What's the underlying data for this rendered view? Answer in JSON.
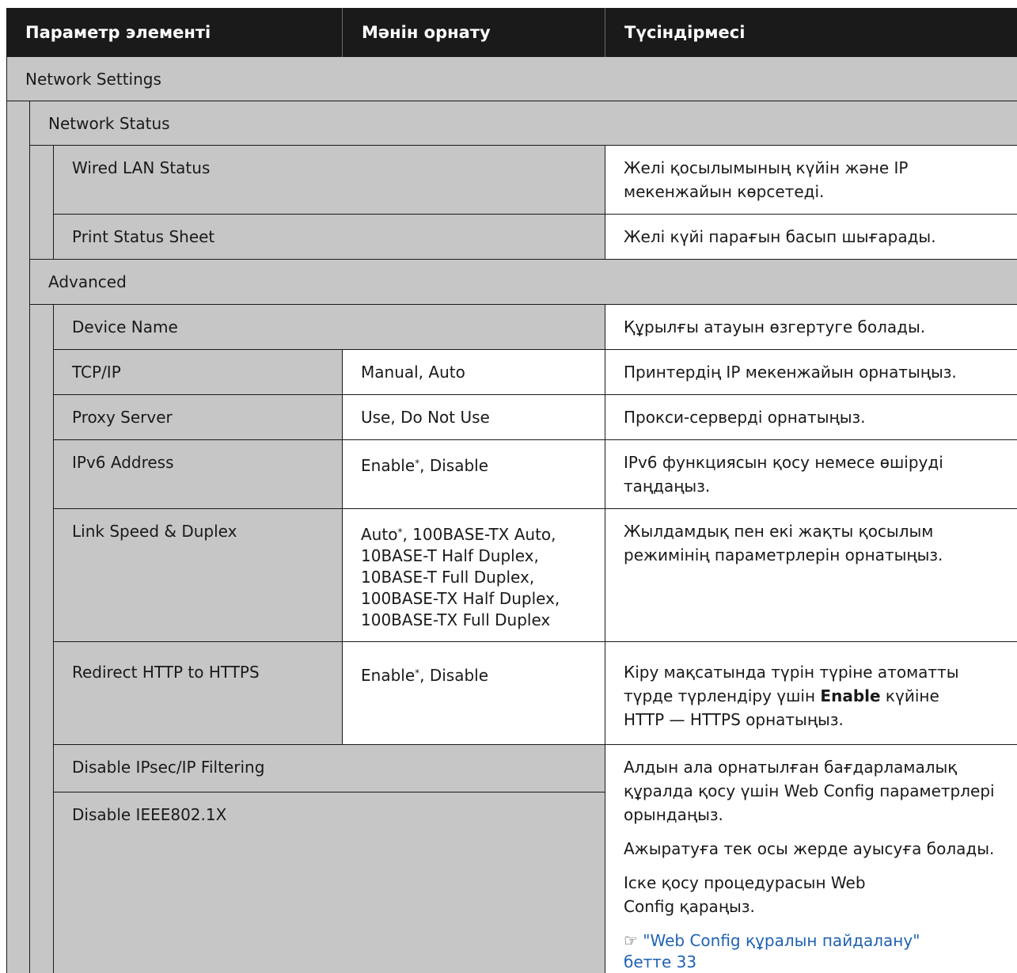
{
  "header": {
    "col1": "Параметр элементі",
    "col2": "Мәнін орнату",
    "col3": "Түсіндірмесі"
  },
  "sections": {
    "network_settings": "Network Settings",
    "network_status": "Network Status",
    "advanced": "Advanced"
  },
  "rows": {
    "wired_lan": {
      "name": "Wired LAN Status",
      "desc_1": "Желі қосылымының күйін және IP",
      "desc_2": "мекенжайын көрсетеді."
    },
    "print_status": {
      "name": "Print Status Sheet",
      "desc": "Желі күйі парағын басып шығарады."
    },
    "device_name": {
      "name": "Device Name",
      "desc": "Құрылғы атауын өзгертуге болады."
    },
    "tcpip": {
      "name": "TCP/IP",
      "value": "Manual, Auto",
      "desc": "Принтердің IP мекенжайын орнатыңыз."
    },
    "proxy": {
      "name": "Proxy Server",
      "value": "Use, Do Not Use",
      "desc": "Прокси-серверді орнатыңыз."
    },
    "ipv6": {
      "name": "IPv6 Address",
      "value_a": "Enable",
      "value_b": ", Disable",
      "desc_1": "IPv6 функциясын қосу немесе өшіруді",
      "desc_2": "таңдаңыз."
    },
    "link_speed": {
      "name": "Link Speed & Duplex",
      "value_a": "Auto",
      "value_b": ", 100BASE-TX Auto,",
      "value_2": "10BASE-T Half Duplex,",
      "value_3": "10BASE-T Full Duplex,",
      "value_4": "100BASE-TX Half Duplex,",
      "value_5": "100BASE-TX Full Duplex",
      "desc_1": "Жылдамдық пен екі жақты қосылым",
      "desc_2": "режимінің параметрлерін орнатыңыз."
    },
    "redirect": {
      "name": "Redirect HTTP to HTTPS",
      "value_a": "Enable",
      "value_b": ", Disable",
      "desc_1": "Кіру мақсатында түрін түріне атоматты",
      "desc_2a": "түрде түрлендіру үшін ",
      "desc_2b": "Enable",
      "desc_2c": " күйіне",
      "desc_3": "HTTP — HTTPS орнатыңыз."
    },
    "ipsec": {
      "name": "Disable IPsec/IP Filtering"
    },
    "ieee": {
      "name": "Disable IEEE802.1X"
    },
    "ipsec_desc": {
      "p1_1": "Алдын ала орнатылған бағдарламалық",
      "p1_2": "құралда қосу үшін Web Config параметрлері",
      "p1_3": "орындаңыз.",
      "p2": "Ажыратуға тек осы жерде ауысуға болады.",
      "p3_1": "Іске қосу процедурасын Web",
      "p3_2": "Config қараңыз.",
      "link_icon": "☞",
      "link_1": " \"Web Config құралын пайдалану\"",
      "link_2": "бетте 33"
    }
  },
  "colors": {
    "header_bg": "#1a1a1a",
    "row_gray": "#c6c6c6",
    "link": "#1f62b3"
  }
}
